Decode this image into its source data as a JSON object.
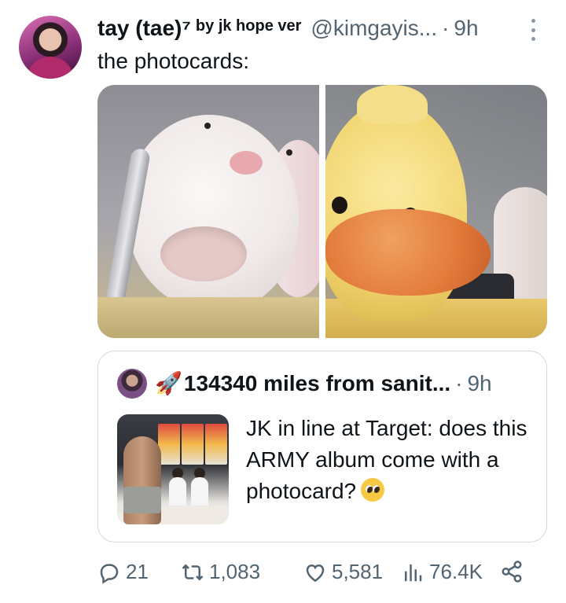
{
  "tweet": {
    "display_name": "tay (tae)⁷",
    "name_suffix": "by jk hope ver",
    "handle": "@kimgayis...",
    "separator": "·",
    "time": "9h",
    "text": "the photocards:",
    "more_icon": "more-vertical-icon"
  },
  "media": {
    "images": [
      {
        "name": "photo-bunny-puppet"
      },
      {
        "name": "photo-duck-puppet"
      }
    ]
  },
  "quote": {
    "name_emoji": "🚀",
    "display_name": "134340 miles from sanit...",
    "separator": "·",
    "time": "9h",
    "text": "JK in line at Target: does this ARMY album come with a photocard?"
  },
  "actions": {
    "reply_count": "21",
    "retweet_count": "1,083",
    "like_count": "5,581",
    "views_count": "76.4K"
  },
  "colors": {
    "text_primary": "#0f1419",
    "text_secondary": "#536471",
    "border": "#cfd9de"
  }
}
